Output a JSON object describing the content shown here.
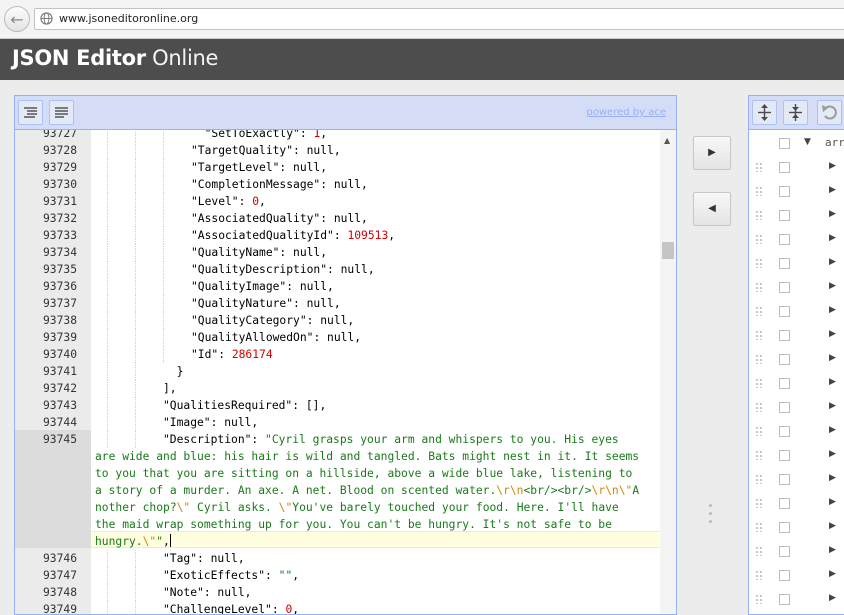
{
  "browser": {
    "url": "www.jsoneditoronline.org",
    "back_icon": "back-arrow-icon",
    "site_icon": "globe-icon"
  },
  "app": {
    "title_strong": "JSON Editor",
    "title_light": "Online"
  },
  "code_editor": {
    "powered_by": "powered by ace",
    "format_icon": "format-icon",
    "compact_icon": "compact-icon",
    "lines": [
      {
        "num": "93727",
        "indent": 3,
        "html": "  <span class=\"key\">\"SetToExactly\"</span>: <span class=\"n\">1</span>,"
      },
      {
        "num": "93728",
        "indent": 3,
        "html": "<span class=\"key\">\"TargetQuality\"</span>: null,"
      },
      {
        "num": "93729",
        "indent": 3,
        "html": "<span class=\"key\">\"TargetLevel\"</span>: null,"
      },
      {
        "num": "93730",
        "indent": 3,
        "html": "<span class=\"key\">\"CompletionMessage\"</span>: null,"
      },
      {
        "num": "93731",
        "indent": 3,
        "html": "<span class=\"key\">\"Level\"</span>: <span class=\"n\">0</span>,"
      },
      {
        "num": "93732",
        "indent": 3,
        "html": "<span class=\"key\">\"AssociatedQuality\"</span>: null,"
      },
      {
        "num": "93733",
        "indent": 3,
        "html": "<span class=\"key\">\"AssociatedQualityId\"</span>: <span class=\"n\">109513</span>,"
      },
      {
        "num": "93734",
        "indent": 3,
        "html": "<span class=\"key\">\"QualityName\"</span>: null,"
      },
      {
        "num": "93735",
        "indent": 3,
        "html": "<span class=\"key\">\"QualityDescription\"</span>: null,"
      },
      {
        "num": "93736",
        "indent": 3,
        "html": "<span class=\"key\">\"QualityImage\"</span>: null,"
      },
      {
        "num": "93737",
        "indent": 3,
        "html": "<span class=\"key\">\"QualityNature\"</span>: null,"
      },
      {
        "num": "93738",
        "indent": 3,
        "html": "<span class=\"key\">\"QualityCategory\"</span>: null,"
      },
      {
        "num": "93739",
        "indent": 3,
        "html": "<span class=\"key\">\"QualityAllowedOn\"</span>: null,"
      },
      {
        "num": "93740",
        "indent": 3,
        "html": "<span class=\"key\">\"Id\"</span>: <span class=\"n\">286174</span>"
      },
      {
        "num": "93741",
        "indent": 2,
        "html": "  }"
      },
      {
        "num": "93742",
        "indent": 2,
        "html": "],"
      },
      {
        "num": "93743",
        "indent": 2,
        "html": "<span class=\"key\">\"QualitiesRequired\"</span>: [],"
      },
      {
        "num": "93744",
        "indent": 2,
        "html": "<span class=\"key\">\"Image\"</span>: null,"
      },
      {
        "num": "93745",
        "indent": 2,
        "html": "<span class=\"key\">\"Description\"</span>: <span class=\"s\">\"Cyril grasps your arm and whispers to you. His eyes</span>"
      },
      {
        "num": "",
        "indent": 0,
        "html": "<span class=\"s\">are wide and blue: his hair is wild and tangled. Bats might nest in it. It seems</span>"
      },
      {
        "num": "",
        "indent": 0,
        "html": "<span class=\"s\">to you that you are sitting on a hillside, above a wide blue lake, listening to</span>"
      },
      {
        "num": "",
        "indent": 0,
        "html": "<span class=\"s\">a story of a murder. An axe. A net. Blood on scented water.</span><span class=\"esc\">\\r\\n</span><span class=\"s\">&lt;br/&gt;&lt;br/&gt;</span><span class=\"esc\">\\r\\n\\\"</span><span class=\"s\">A</span>"
      },
      {
        "num": "",
        "indent": 0,
        "html": "<span class=\"s\">nother chop?</span><span class=\"esc\">\\\"</span><span class=\"s\"> Cyril asks. </span><span class=\"esc\">\\\"</span><span class=\"s\">You've barely touched your food. Here. I'll have</span>"
      },
      {
        "num": "",
        "indent": 0,
        "html": "<span class=\"s\">the maid wrap something up for you. You can't be hungry. It's not safe to be</span>"
      },
      {
        "num": "",
        "indent": 0,
        "html": "<span class=\"s\">hungry.</span><span class=\"esc\">\\\"</span><span class=\"s\">\"</span>,<span class=\"cursor\"></span>"
      },
      {
        "num": "93746",
        "indent": 2,
        "html": "<span class=\"key\">\"Tag\"</span>: null,"
      },
      {
        "num": "93747",
        "indent": 2,
        "html": "<span class=\"key\">\"ExoticEffects\"</span>: <span class=\"s\">\"\"</span>,"
      },
      {
        "num": "93748",
        "indent": 2,
        "html": "<span class=\"key\">\"Note\"</span>: null,"
      },
      {
        "num": "93749",
        "indent": 2,
        "html": "<span class=\"key\">\"ChallengeLevel\"</span>: <span class=\"n\">0</span>,"
      }
    ]
  },
  "copy_buttons": {
    "to_right": "▶",
    "to_left": "◀"
  },
  "tree_editor": {
    "root_key": "arr",
    "expand_all_icon": "expand-all-icon",
    "collapse_all_icon": "collapse-all-icon",
    "undo_icon": "undo-icon"
  }
}
